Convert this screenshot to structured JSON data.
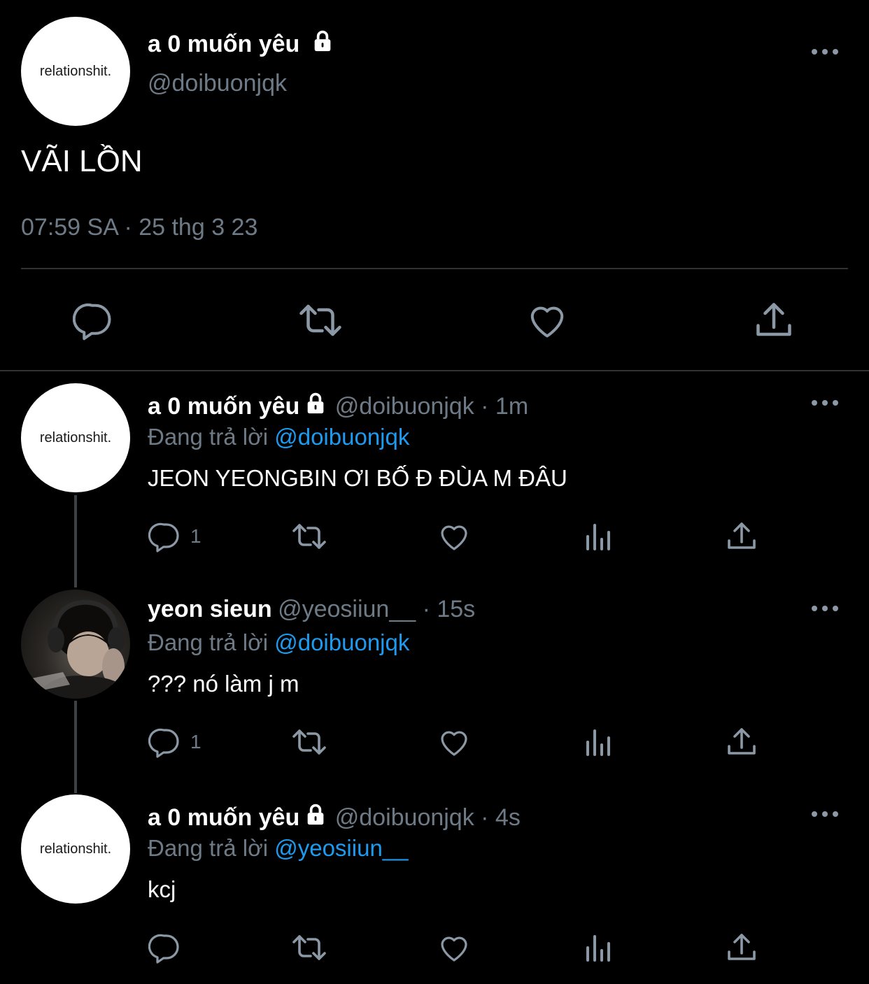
{
  "main_tweet": {
    "avatar_text": "relationshit.",
    "name": "a 0 muốn yêu",
    "handle": "@doibuonjqk",
    "text": "VÃI LỒN",
    "timestamp": "07:59 SA · 25 thg 3 23"
  },
  "replies": [
    {
      "avatar_text": "relationshit.",
      "name": "a 0 muốn yêu",
      "handle_time": "@doibuonjqk · 1m",
      "replying_prefix": "Đang trả lời",
      "replying_to": "@doibuonjqk",
      "text": "JEON YEONGBIN ƠI BỐ Đ ĐÙA M ĐÂU",
      "reply_count": "1"
    },
    {
      "avatar_text": "",
      "name": "yeon sieun",
      "handle_time": "@yeosiiun__ · 15s",
      "replying_prefix": "Đang trả lời",
      "replying_to": "@doibuonjqk",
      "text": "??? nó làm j m",
      "reply_count": "1"
    },
    {
      "avatar_text": "relationshit.",
      "name": "a 0 muốn yêu",
      "handle_time": "@doibuonjqk · 4s",
      "replying_prefix": "Đang trả lời",
      "replying_to": "@yeosiiun__",
      "text": "kcj",
      "reply_count": ""
    }
  ],
  "colors": {
    "background": "#000000",
    "secondary_text": "#6e7b87",
    "link": "#1d9bf0",
    "divider": "#2f3336"
  }
}
